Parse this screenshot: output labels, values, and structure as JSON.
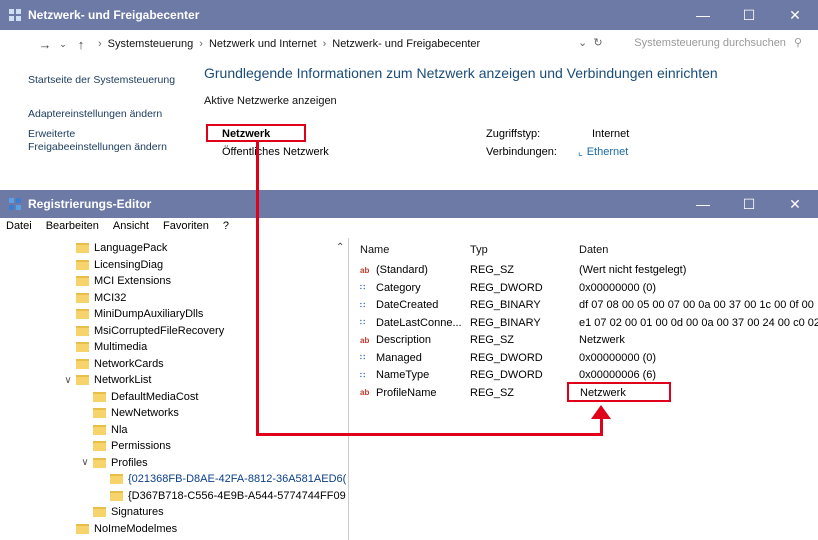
{
  "win1": {
    "title": "Netzwerk- und Freigabecenter",
    "breadcrumb": [
      "Systemsteuerung",
      "Netzwerk und Internet",
      "Netzwerk- und Freigabecenter"
    ],
    "search_placeholder": "Systemsteuerung durchsuchen",
    "sidebar": [
      "Startseite der Systemsteuerung",
      "Adaptereinstellungen ändern",
      "Erweiterte Freigabeeinstellungen ändern"
    ],
    "heading": "Grundlegende Informationen zum Netzwerk anzeigen und Verbindungen einrichten",
    "active_label": "Aktive Netzwerke anzeigen",
    "network_name": "Netzwerk",
    "network_type": "Öffentliches Netzwerk",
    "access_label": "Zugriffstyp:",
    "access_value": "Internet",
    "conn_label": "Verbindungen:",
    "conn_value": "Ethernet"
  },
  "win2": {
    "title": "Registrierungs-Editor",
    "menu": [
      "Datei",
      "Bearbeiten",
      "Ansicht",
      "Favoriten",
      "?"
    ],
    "tree": [
      {
        "label": "LanguagePack",
        "indent": 0,
        "chev": ""
      },
      {
        "label": "LicensingDiag",
        "indent": 0,
        "chev": ""
      },
      {
        "label": "MCI Extensions",
        "indent": 0,
        "chev": ""
      },
      {
        "label": "MCI32",
        "indent": 0,
        "chev": ""
      },
      {
        "label": "MiniDumpAuxiliaryDlls",
        "indent": 0,
        "chev": ""
      },
      {
        "label": "MsiCorruptedFileRecovery",
        "indent": 0,
        "chev": ""
      },
      {
        "label": "Multimedia",
        "indent": 0,
        "chev": ""
      },
      {
        "label": "NetworkCards",
        "indent": 0,
        "chev": ""
      },
      {
        "label": "NetworkList",
        "indent": 0,
        "chev": "v"
      },
      {
        "label": "DefaultMediaCost",
        "indent": 1,
        "chev": ""
      },
      {
        "label": "NewNetworks",
        "indent": 1,
        "chev": ""
      },
      {
        "label": "Nla",
        "indent": 1,
        "chev": ""
      },
      {
        "label": "Permissions",
        "indent": 1,
        "chev": ""
      },
      {
        "label": "Profiles",
        "indent": 1,
        "chev": "v"
      },
      {
        "label": "{021368FB-D8AE-42FA-8812-36A581AED6(",
        "indent": 2,
        "chev": "",
        "selected": true
      },
      {
        "label": "{D367B718-C556-4E9B-A544-5774744FF09",
        "indent": 2,
        "chev": ""
      },
      {
        "label": "Signatures",
        "indent": 1,
        "chev": ""
      },
      {
        "label": "NoImeModelmes",
        "indent": 0,
        "chev": ""
      }
    ],
    "columns": [
      "Name",
      "Typ",
      "Daten"
    ],
    "values": [
      {
        "name": "(Standard)",
        "type": "REG_SZ",
        "data": "(Wert nicht festgelegt)",
        "icon": "ab"
      },
      {
        "name": "Category",
        "type": "REG_DWORD",
        "data": "0x00000000 (0)",
        "icon": "bin"
      },
      {
        "name": "DateCreated",
        "type": "REG_BINARY",
        "data": "df 07 08 00 05 00 07 00 0a 00 37 00 1c 00 0f 00",
        "icon": "bin"
      },
      {
        "name": "DateLastConne...",
        "type": "REG_BINARY",
        "data": "e1 07 02 00 01 00 0d 00 0a 00 37 00 24 00 c0 02",
        "icon": "bin"
      },
      {
        "name": "Description",
        "type": "REG_SZ",
        "data": "Netzwerk",
        "icon": "ab"
      },
      {
        "name": "Managed",
        "type": "REG_DWORD",
        "data": "0x00000000 (0)",
        "icon": "bin"
      },
      {
        "name": "NameType",
        "type": "REG_DWORD",
        "data": "0x00000006 (6)",
        "icon": "bin"
      },
      {
        "name": "ProfileName",
        "type": "REG_SZ",
        "data": "Netzwerk",
        "icon": "ab"
      }
    ]
  }
}
